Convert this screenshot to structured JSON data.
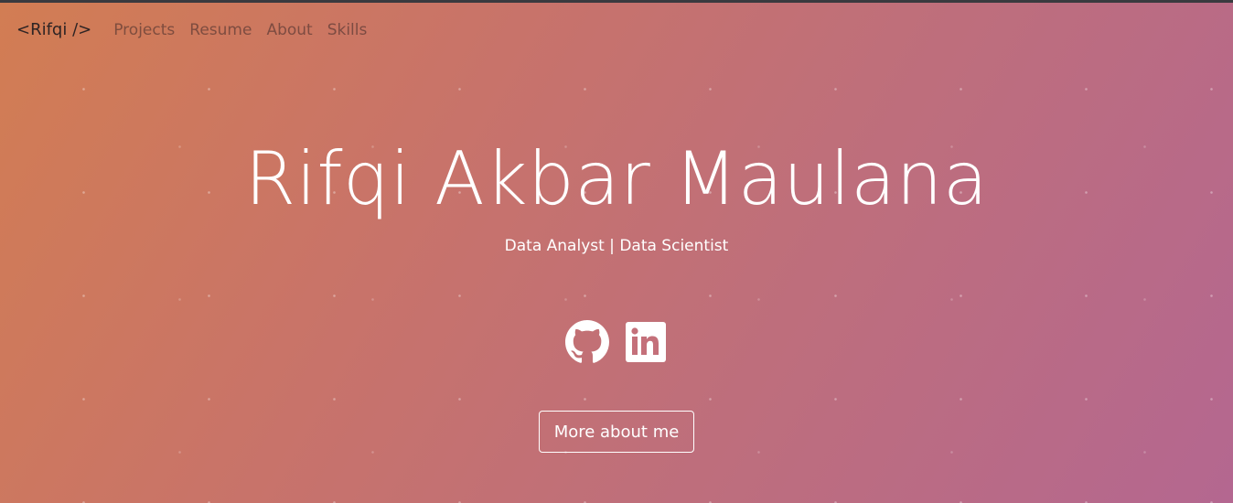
{
  "nav": {
    "brand": "<Rifqi />",
    "links": [
      "Projects",
      "Resume",
      "About",
      "Skills"
    ]
  },
  "hero": {
    "title": "Rifqi Akbar Maulana",
    "subtitle": "Data Analyst | Data Scientist"
  },
  "socials": [
    {
      "icon": "github-icon"
    },
    {
      "icon": "linkedin-icon"
    }
  ],
  "cta": {
    "label": "More about me"
  },
  "colors": {
    "gradient_start": "#d27d53",
    "gradient_end": "#b46790",
    "text_light": "#ffffff"
  }
}
